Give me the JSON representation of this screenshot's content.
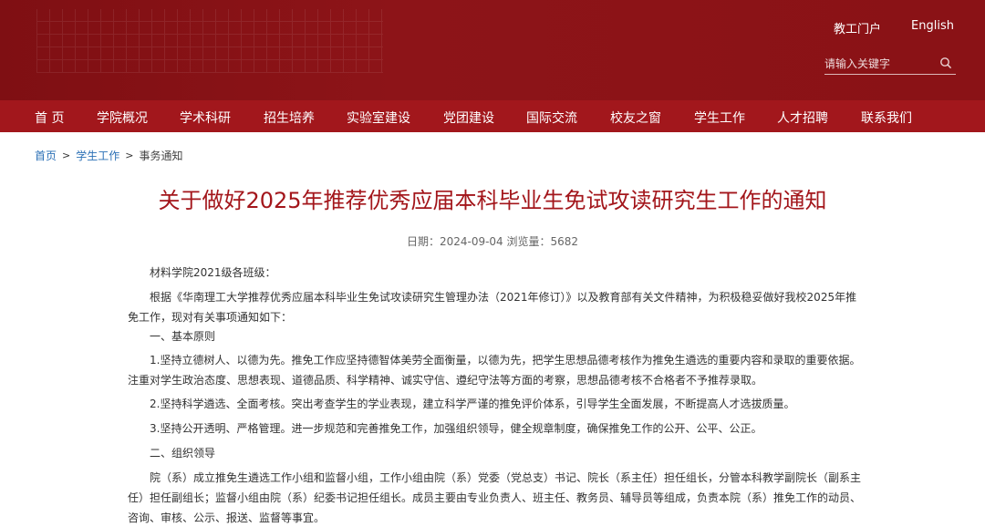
{
  "header": {
    "portal_label": "教工门户",
    "english_label": "English",
    "search_placeholder": "请输入关键字",
    "brand_color": "#8a1216"
  },
  "nav": {
    "items": [
      {
        "label": "首 页"
      },
      {
        "label": "学院概况"
      },
      {
        "label": "学术科研"
      },
      {
        "label": "招生培养"
      },
      {
        "label": "实验室建设"
      },
      {
        "label": "党团建设"
      },
      {
        "label": "国际交流"
      },
      {
        "label": "校友之窗"
      },
      {
        "label": "学生工作"
      },
      {
        "label": "人才招聘"
      },
      {
        "label": "联系我们"
      }
    ],
    "bg_color": "#a2171c"
  },
  "breadcrumb": {
    "home": "首页",
    "section": "学生工作",
    "current": "事务通知",
    "separator": ">"
  },
  "article": {
    "title": "关于做好2025年推荐优秀应届本科毕业生免试攻读研究生工作的通知",
    "meta": "日期：2024-09-04 浏览量：5682",
    "paragraphs": [
      "材料学院2021级各班级：",
      "根据《华南理工大学推荐优秀应届本科毕业生免试攻读研究生管理办法（2021年修订）》以及教育部有关文件精神，为积极稳妥做好我校2025年推免工作，现对有关事项通知如下：",
      "一、基本原则",
      "1.坚持立德树人、以德为先。推免工作应坚持德智体美劳全面衡量，以德为先，把学生思想品德考核作为推免生遴选的重要内容和录取的重要依据。注重对学生政治态度、思想表现、道德品质、科学精神、诚实守信、遵纪守法等方面的考察，思想品德考核不合格者不予推荐录取。",
      "2.坚持科学遴选、全面考核。突出考查学生的学业表现，建立科学严谨的推免评价体系，引导学生全面发展，不断提高人才选拔质量。",
      "3.坚持公开透明、严格管理。进一步规范和完善推免工作，加强组织领导，健全规章制度，确保推免工作的公开、公平、公正。",
      "二、组织领导",
      "院（系）成立推免生遴选工作小组和监督小组，工作小组由院（系）党委（党总支）书记、院长（系主任）担任组长，分管本科教学副院长（副系主任）担任副组长；监督小组由院（系）纪委书记担任组长。成员主要由专业负责人、班主任、教务员、辅导员等组成，负责本院（系）推免工作的动员、咨询、审核、公示、报送、监督等事宜。"
    ]
  }
}
